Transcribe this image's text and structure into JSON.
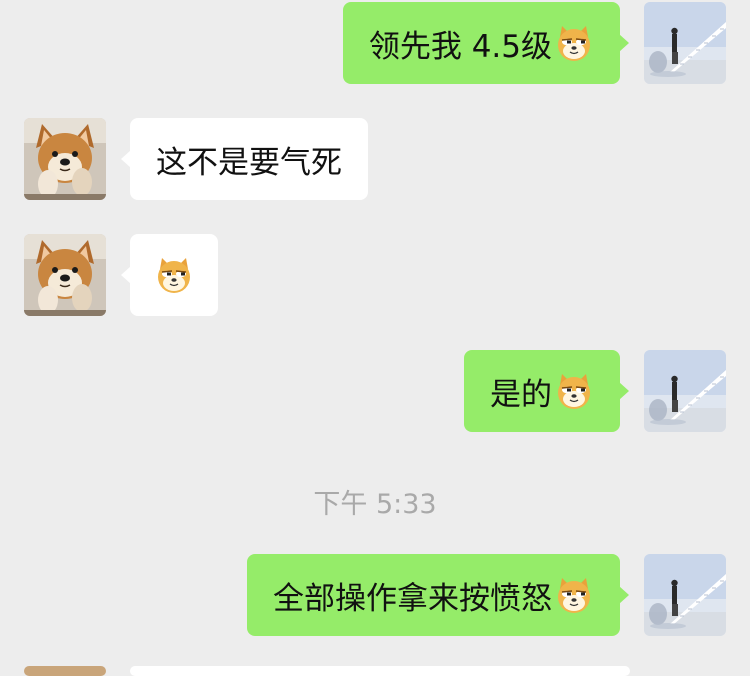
{
  "chat": {
    "timestamp": "下午 5:33",
    "messages": [
      {
        "sender": "me",
        "text": "领先我 4.5级",
        "emoji": "doge-emoji"
      },
      {
        "sender": "friend",
        "text": "这不是要气死",
        "emoji": null
      },
      {
        "sender": "friend",
        "text": "",
        "emoji": "doge-emoji"
      },
      {
        "sender": "me",
        "text": "是的",
        "emoji": "doge-emoji"
      },
      {
        "sender": "me",
        "text": "全部操作拿来按愤怒",
        "emoji": "doge-emoji"
      }
    ]
  },
  "avatars": {
    "me": "man-on-stairs-avatar",
    "friend": "shiba-dog-avatar"
  },
  "colors": {
    "background": "#ededed",
    "my_bubble": "#95ec69",
    "their_bubble": "#ffffff",
    "timestamp_text": "#a9a9a9"
  }
}
